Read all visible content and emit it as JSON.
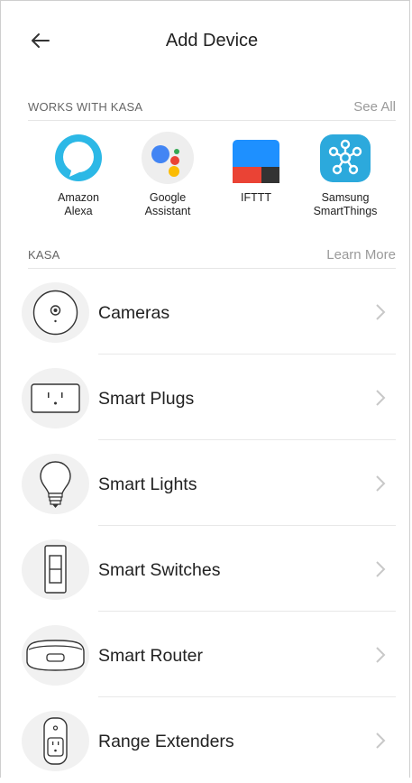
{
  "header": {
    "title": "Add Device",
    "back_icon": "arrow-left-icon"
  },
  "works_with": {
    "label": "WORKS WITH KASA",
    "action": "See All",
    "partners": [
      {
        "name_line1": "Amazon",
        "name_line2": "Alexa",
        "icon": "alexa-icon",
        "color": "#2cb8e6"
      },
      {
        "name_line1": "Google",
        "name_line2": "Assistant",
        "icon": "google-assistant-icon",
        "color": "#4285f4"
      },
      {
        "name_line1": "IFTTT",
        "name_line2": "",
        "icon": "ifttt-icon",
        "color": "#1e90ff"
      },
      {
        "name_line1": "Samsung",
        "name_line2": "SmartThings",
        "icon": "smartthings-icon",
        "color": "#2ca9dc"
      }
    ]
  },
  "kasa": {
    "label": "KASA",
    "action": "Learn More",
    "items": [
      {
        "label": "Cameras",
        "icon": "camera-icon"
      },
      {
        "label": "Smart Plugs",
        "icon": "smart-plug-icon"
      },
      {
        "label": "Smart Lights",
        "icon": "light-bulb-icon"
      },
      {
        "label": "Smart Switches",
        "icon": "light-switch-icon"
      },
      {
        "label": "Smart Router",
        "icon": "router-icon"
      },
      {
        "label": "Range Extenders",
        "icon": "range-extender-icon"
      }
    ]
  }
}
